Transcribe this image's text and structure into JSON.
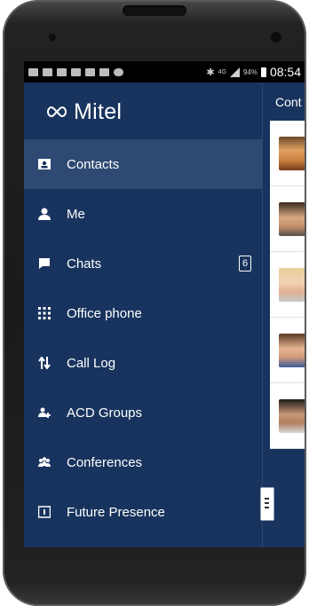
{
  "status_bar": {
    "network": "4G",
    "battery_percent": "94%",
    "time": "08:54"
  },
  "brand": {
    "name": "Mitel"
  },
  "menu": [
    {
      "label": "Contacts",
      "icon": "contacts-icon",
      "active": true
    },
    {
      "label": "Me",
      "icon": "person-icon"
    },
    {
      "label": "Chats",
      "icon": "chat-icon",
      "badge": "6"
    },
    {
      "label": "Office phone",
      "icon": "dialpad-icon"
    },
    {
      "label": "Call Log",
      "icon": "call-log-icon"
    },
    {
      "label": "ACD Groups",
      "icon": "acd-groups-icon"
    },
    {
      "label": "Conferences",
      "icon": "conferences-icon"
    },
    {
      "label": "Future Presence",
      "icon": "calendar-icon"
    }
  ],
  "contacts_panel": {
    "title": "Cont"
  },
  "colors": {
    "drawer_bg": "#18345e",
    "active_bg": "#2e4a73"
  }
}
